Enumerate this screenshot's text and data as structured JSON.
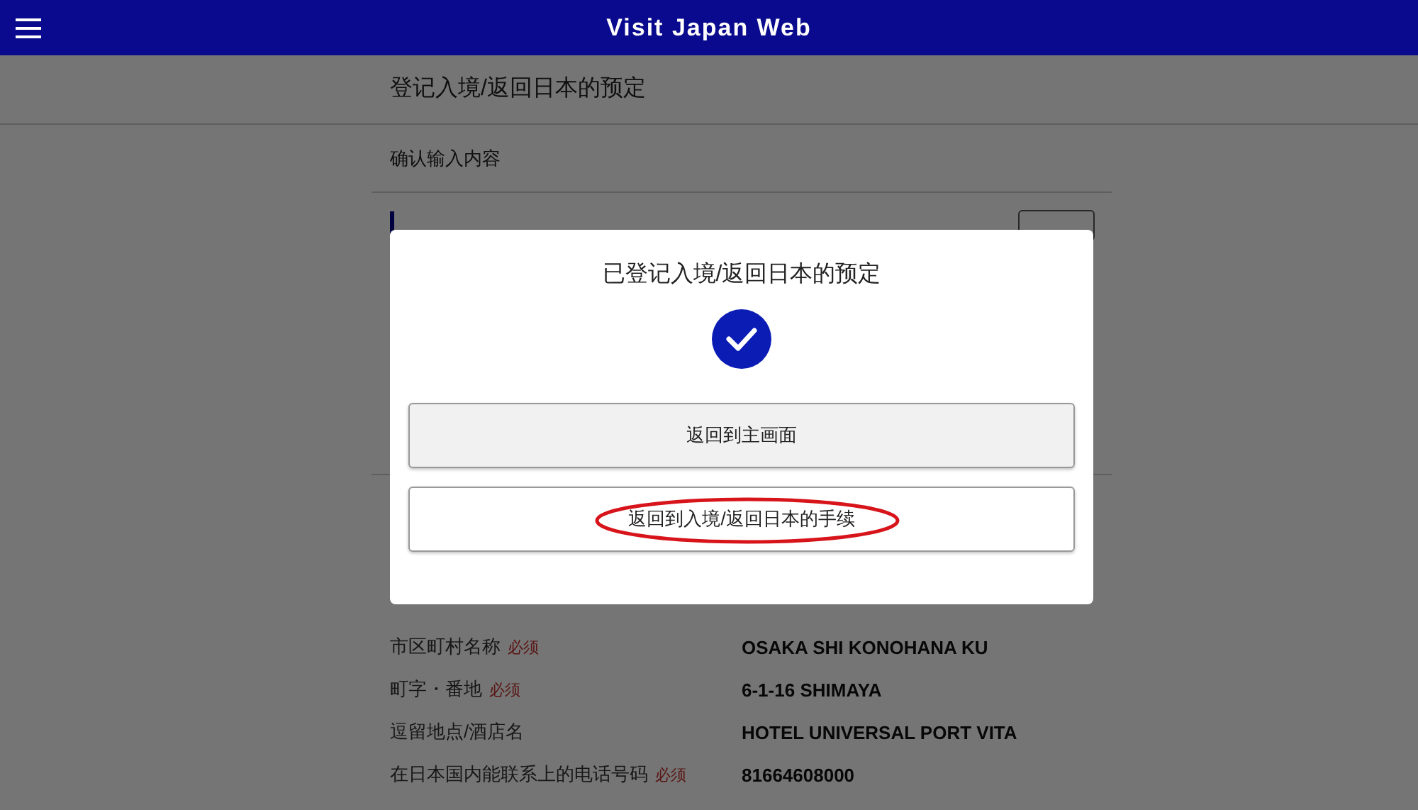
{
  "header": {
    "title": "Visit Japan Web"
  },
  "page_title": "登记入境/返回日本的预定",
  "step_title": "确认输入内容",
  "fields": [
    {
      "label": "市区町村名称",
      "required": "必须",
      "value": "OSAKA SHI KONOHANA KU"
    },
    {
      "label": "町字・番地",
      "required": "必须",
      "value": "6-1-16 SHIMAYA"
    },
    {
      "label": "逗留地点/酒店名",
      "value": "HOTEL UNIVERSAL PORT VITA"
    },
    {
      "label": "在日本国内能联系上的电话号码",
      "required": "必须",
      "value": "81664608000"
    }
  ],
  "dialog": {
    "title": "已登记入境/返回日本的预定",
    "buttons": [
      {
        "label": "返回到主画面",
        "kind": "filled",
        "highlighted": false
      },
      {
        "label": "返回到入境/返回日本的手续",
        "kind": "outline",
        "highlighted": true
      }
    ]
  }
}
